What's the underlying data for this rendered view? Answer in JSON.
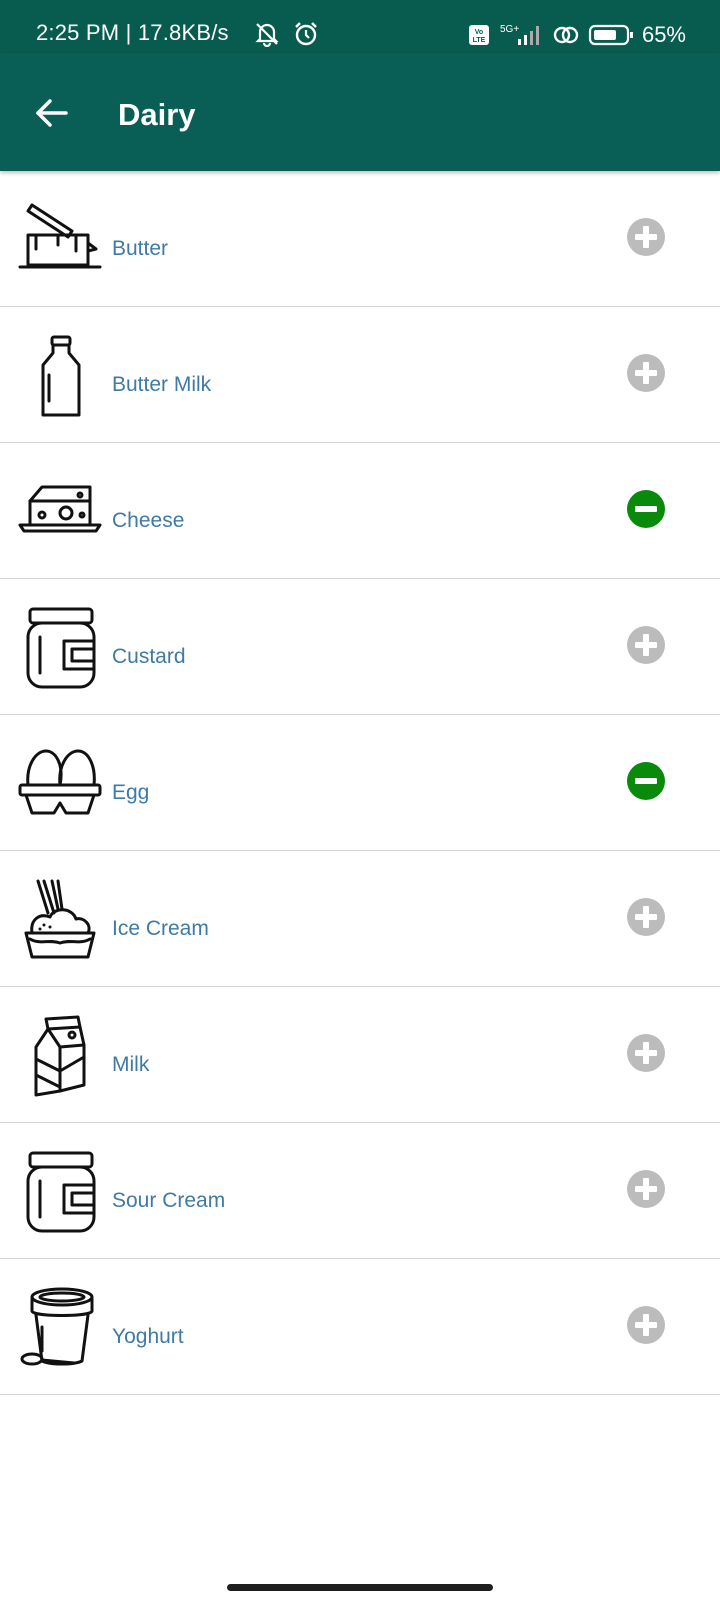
{
  "status_bar": {
    "time_speed": "2:25 PM | 17.8KB/s",
    "network": "5G+",
    "volte": "Vo LTE",
    "battery": "65%"
  },
  "header": {
    "title": "Dairy",
    "back_icon": "arrow-left-icon"
  },
  "colors": {
    "app_bar": "#095f55",
    "status_bar": "#085c4f",
    "item_text": "#3f7aa6",
    "add_button": "#bcbcbc",
    "remove_button": "#0a8a0a"
  },
  "items": [
    {
      "label": "Butter",
      "icon": "butter-icon",
      "state": "add"
    },
    {
      "label": "Butter Milk",
      "icon": "milk-bottle-icon",
      "state": "add"
    },
    {
      "label": "Cheese",
      "icon": "cheese-icon",
      "state": "remove"
    },
    {
      "label": "Custard",
      "icon": "jar-icon",
      "state": "add"
    },
    {
      "label": "Egg",
      "icon": "egg-carton-icon",
      "state": "remove"
    },
    {
      "label": "Ice Cream",
      "icon": "ice-cream-icon",
      "state": "add"
    },
    {
      "label": "Milk",
      "icon": "milk-carton-icon",
      "state": "add"
    },
    {
      "label": "Sour Cream",
      "icon": "jar-icon",
      "state": "add"
    },
    {
      "label": "Yoghurt",
      "icon": "yoghurt-icon",
      "state": "add"
    }
  ]
}
